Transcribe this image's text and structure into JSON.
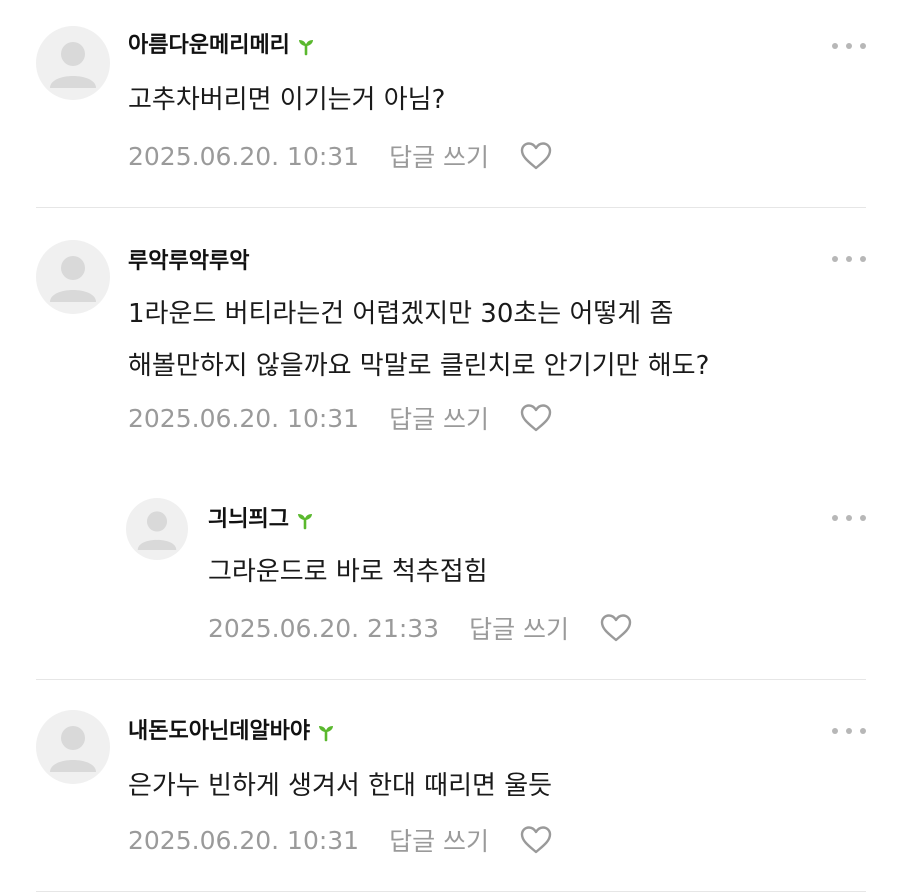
{
  "actions": {
    "reply_label": "답글 쓰기"
  },
  "comments": [
    {
      "username": "아름다운메리메리",
      "text": "고추차버리면 이기는거 아님?",
      "date": "2025.06.20. 10:31"
    },
    {
      "username": "루악루악루악",
      "text_line1": "1라운드 버티라는건 어렵겠지만 30초는 어떻게 좀",
      "text_line2": "해볼만하지 않을까요 막말로 클린치로 안기기만 해도?",
      "date": "2025.06.20. 10:31"
    },
    {
      "username": "긔늬픠그",
      "text": "그라운드로 바로 척추접힘",
      "date": "2025.06.20. 21:33"
    },
    {
      "username": "내돈도아닌데알바야",
      "text": "은가누 빈하게 생겨서 한대 때리면 울듯",
      "date": "2025.06.20. 10:31"
    }
  ],
  "colors": {
    "sprout": "#5ab82e",
    "meta_text": "#9a9a9a",
    "divider": "#e6e6e6"
  }
}
